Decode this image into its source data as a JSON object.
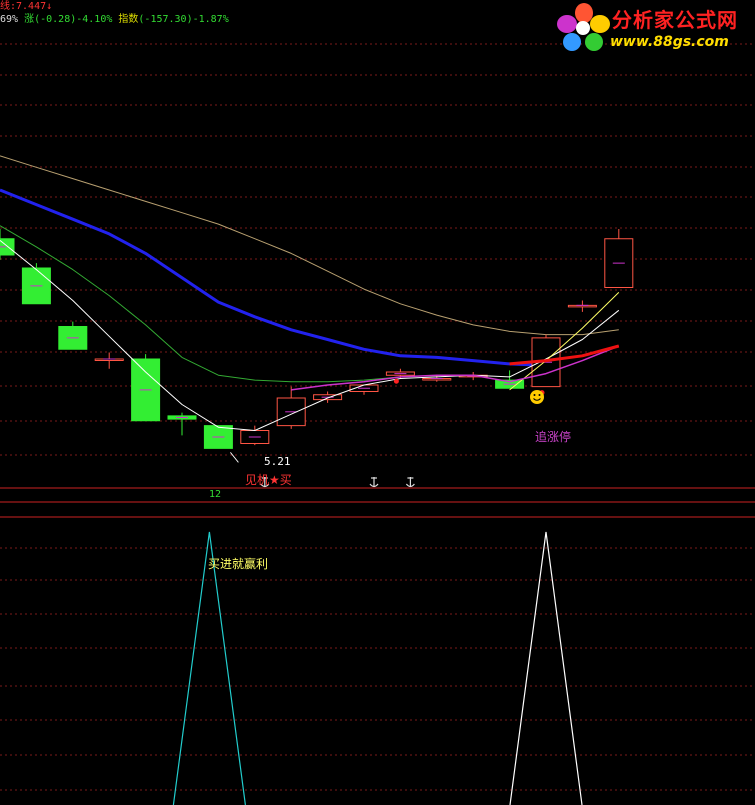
{
  "header": {
    "line1": "线:7.447↓",
    "line2_pct": "69%",
    "line2_change": "涨(-0.28)-4.10%",
    "line2_index_label": "指数",
    "line2_index": "(-157.30)-1.87%"
  },
  "logo": {
    "name_cn": "分析家公式网",
    "url": "www.88gs.com",
    "icon": "flower-logo-icon"
  },
  "annotations": {
    "low_price": "5.21",
    "buy_signal": "见机★买",
    "chase_limit_up": "追涨停",
    "buy_profit": "买进就赢利",
    "count": "12",
    "smiley": "smiley-icon",
    "anchor": "anchor-icon"
  },
  "colors": {
    "up_candle": "#ff5544",
    "down_candle": "#33ee33",
    "ma_blue": "#2222ee",
    "ma_green": "#33aa33",
    "ma_tan": "#b8a070",
    "ma_white": "#ffffff",
    "ma_yellow": "#ffff66",
    "ma_magenta": "#cc33cc",
    "ma_red": "#ee1111",
    "indicator_cyan": "#22cccc",
    "indicator_white": "#ffffff",
    "grid": "#7a1a1a"
  },
  "chart_data": {
    "type": "candlestick",
    "candles": [
      {
        "open": 6.28,
        "high": 6.34,
        "low": 6.15,
        "close": 6.18
      },
      {
        "open": 6.1,
        "high": 6.13,
        "low": 5.88,
        "close": 5.88
      },
      {
        "open": 5.74,
        "high": 5.77,
        "low": 5.6,
        "close": 5.6
      },
      {
        "open": 5.54,
        "high": 5.58,
        "low": 5.48,
        "close": 5.54
      },
      {
        "open": 5.54,
        "high": 5.57,
        "low": 5.16,
        "close": 5.16
      },
      {
        "open": 5.19,
        "high": 5.21,
        "low": 5.07,
        "close": 5.17
      },
      {
        "open": 5.13,
        "high": 5.13,
        "low": 4.99,
        "close": 4.99
      },
      {
        "open": 5.02,
        "high": 5.13,
        "low": 5.01,
        "close": 5.1
      },
      {
        "open": 5.13,
        "high": 5.37,
        "low": 5.11,
        "close": 5.3
      },
      {
        "open": 5.29,
        "high": 5.34,
        "low": 5.27,
        "close": 5.32
      },
      {
        "open": 5.34,
        "high": 5.38,
        "low": 5.32,
        "close": 5.38
      },
      {
        "open": 5.44,
        "high": 5.48,
        "low": 5.42,
        "close": 5.46
      },
      {
        "open": 5.42,
        "high": 5.44,
        "low": 5.4,
        "close": 5.42
      },
      {
        "open": 5.43,
        "high": 5.46,
        "low": 5.41,
        "close": 5.44
      },
      {
        "open": 5.41,
        "high": 5.47,
        "low": 5.36,
        "close": 5.36
      },
      {
        "open": 5.37,
        "high": 5.69,
        "low": 5.37,
        "close": 5.67
      },
      {
        "open": 5.87,
        "high": 5.9,
        "low": 5.83,
        "close": 5.87
      },
      {
        "open": 5.98,
        "high": 6.34,
        "low": 5.98,
        "close": 6.28
      }
    ],
    "ma_tan": [
      6.79,
      6.72,
      6.65,
      6.58,
      6.51,
      6.44,
      6.37,
      6.28,
      6.19,
      6.08,
      5.97,
      5.88,
      5.81,
      5.75,
      5.71,
      5.69,
      5.69,
      5.72
    ],
    "ma_blue": [
      6.58,
      6.49,
      6.4,
      6.31,
      6.19,
      6.04,
      5.89,
      5.8,
      5.72,
      5.66,
      5.6,
      5.56,
      5.55,
      5.53,
      5.51,
      5.5
    ],
    "ma_green": [
      6.36,
      6.23,
      6.09,
      5.93,
      5.75,
      5.55,
      5.44,
      5.41,
      5.4,
      5.4,
      5.41,
      5.43
    ],
    "ma_white": [
      6.27,
      6.09,
      5.9,
      5.68,
      5.46,
      5.26,
      5.12,
      5.1,
      5.2,
      5.3,
      5.38,
      5.42,
      5.43,
      5.44,
      5.43,
      5.54,
      5.66,
      5.84
    ],
    "ma_yellow": [
      5.35,
      5.53,
      5.73,
      5.95
    ],
    "ma_magenta": [
      5.35,
      5.38,
      5.4,
      5.43,
      5.44,
      5.44,
      5.4,
      5.45,
      5.53,
      5.62
    ],
    "ma_red": [
      5.51,
      5.53,
      5.56,
      5.62
    ],
    "signal_low_index": 6,
    "red_dot_indices": [
      11,
      15
    ],
    "anchor_indices": [
      7,
      10,
      11
    ],
    "indicator_peaks": [
      6,
      15
    ]
  }
}
